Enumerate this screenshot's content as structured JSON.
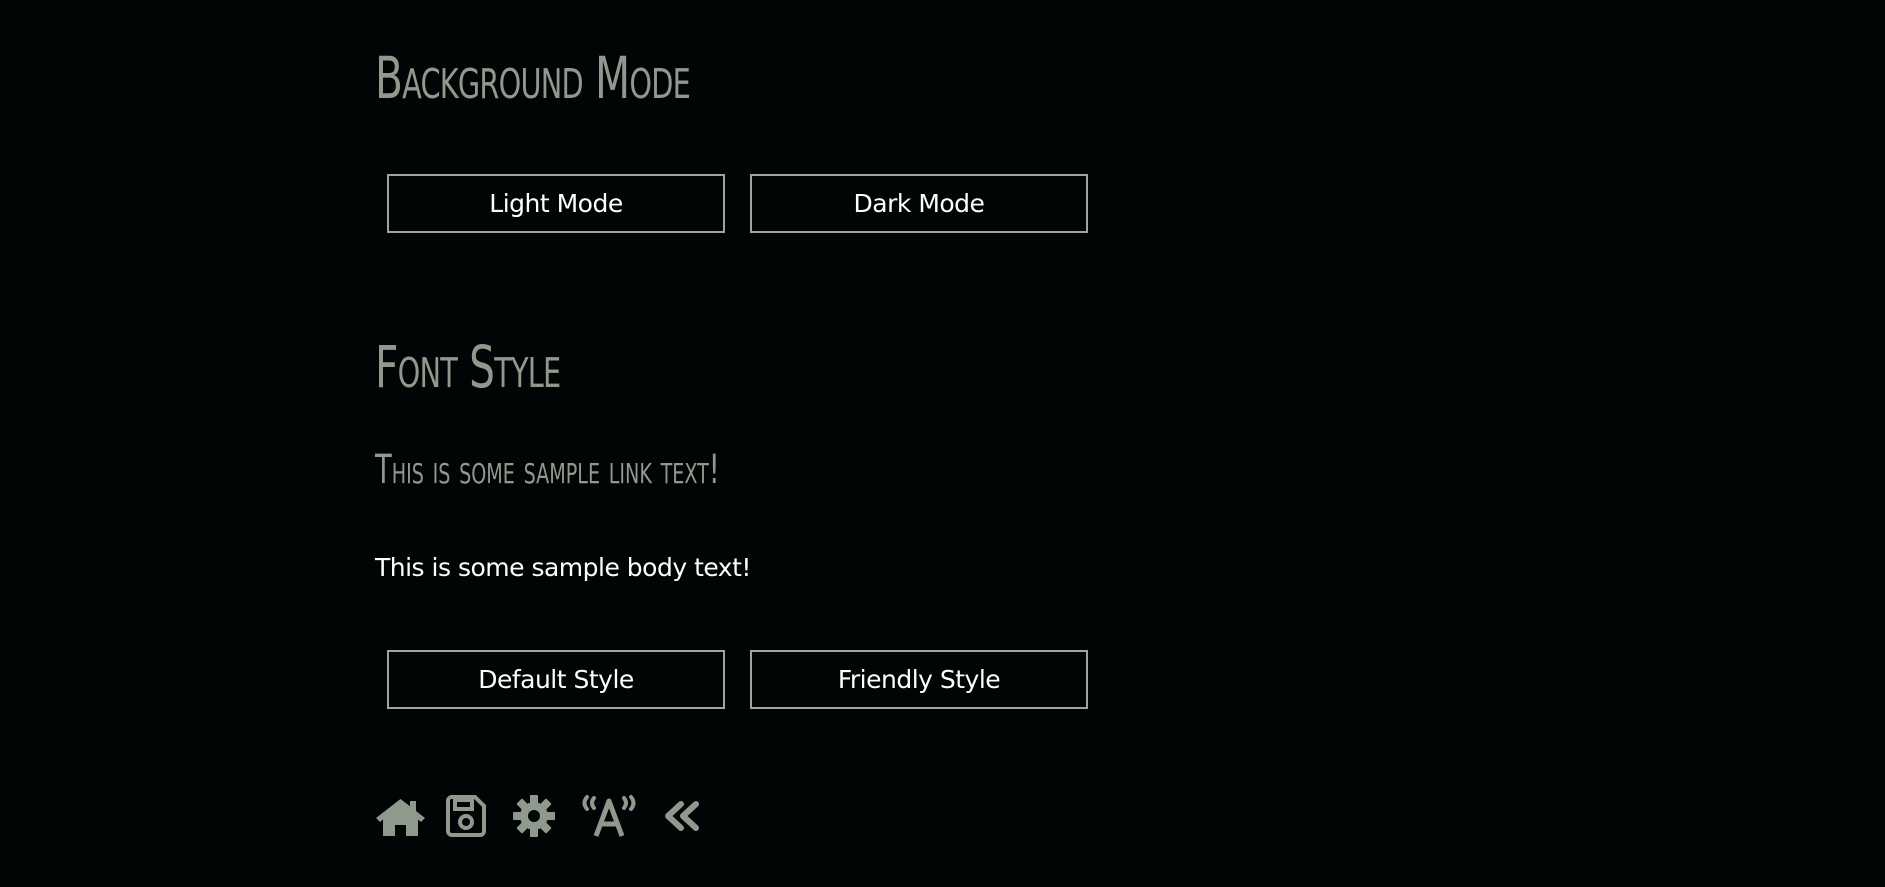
{
  "background_section": {
    "heading": "Background Mode",
    "buttons": {
      "light": "Light Mode",
      "dark": "Dark Mode"
    }
  },
  "font_section": {
    "heading": "Font Style",
    "sample_link": "This is some sample link text!",
    "sample_body": "This is some sample body text!",
    "buttons": {
      "default": "Default Style",
      "friendly": "Friendly Style"
    }
  },
  "toolbar": {
    "icons": [
      "home-icon",
      "save-icon",
      "gear-icon",
      "accessibility-broadcast-icon",
      "double-chevron-left-icon"
    ]
  },
  "colors": {
    "background": "#010506",
    "accent": "#8f9a8d",
    "text": "#ffffff",
    "button_border": "#9ea49e"
  }
}
